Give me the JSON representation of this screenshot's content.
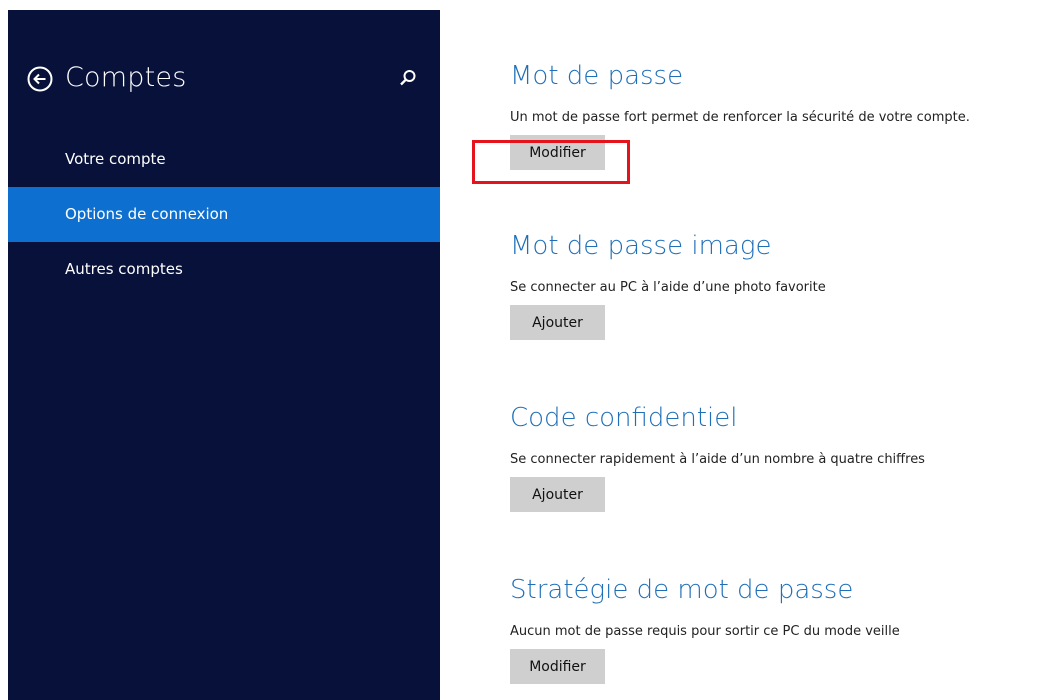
{
  "sidebar": {
    "title": "Comptes",
    "back_icon": "back-arrow-circle-icon",
    "search_icon": "search-icon",
    "items": [
      {
        "label": "Votre compte",
        "selected": false
      },
      {
        "label": "Options de connexion",
        "selected": true
      },
      {
        "label": "Autres comptes",
        "selected": false
      }
    ],
    "colors": {
      "background": "#07113a",
      "selected": "#0d6fcf"
    }
  },
  "sections": [
    {
      "title": "Mot de passe",
      "description": "Un mot de passe fort permet de renforcer la sécurité de votre compte.",
      "button": "Modifier"
    },
    {
      "title": "Mot de passe image",
      "description": "Se connecter au PC à l’aide d’une photo favorite",
      "button": "Ajouter"
    },
    {
      "title": "Code confidentiel",
      "description": "Se connecter rapidement à l’aide d’un nombre à quatre chiffres",
      "button": "Ajouter"
    },
    {
      "title": "Stratégie de mot de passe",
      "description": "Aucun mot de passe requis pour sortir ce PC du mode veille",
      "button": "Modifier"
    }
  ],
  "colors": {
    "accent_title": "#1f6fb8",
    "button_bg": "#cfcfcf",
    "highlight": "#e5131b"
  }
}
